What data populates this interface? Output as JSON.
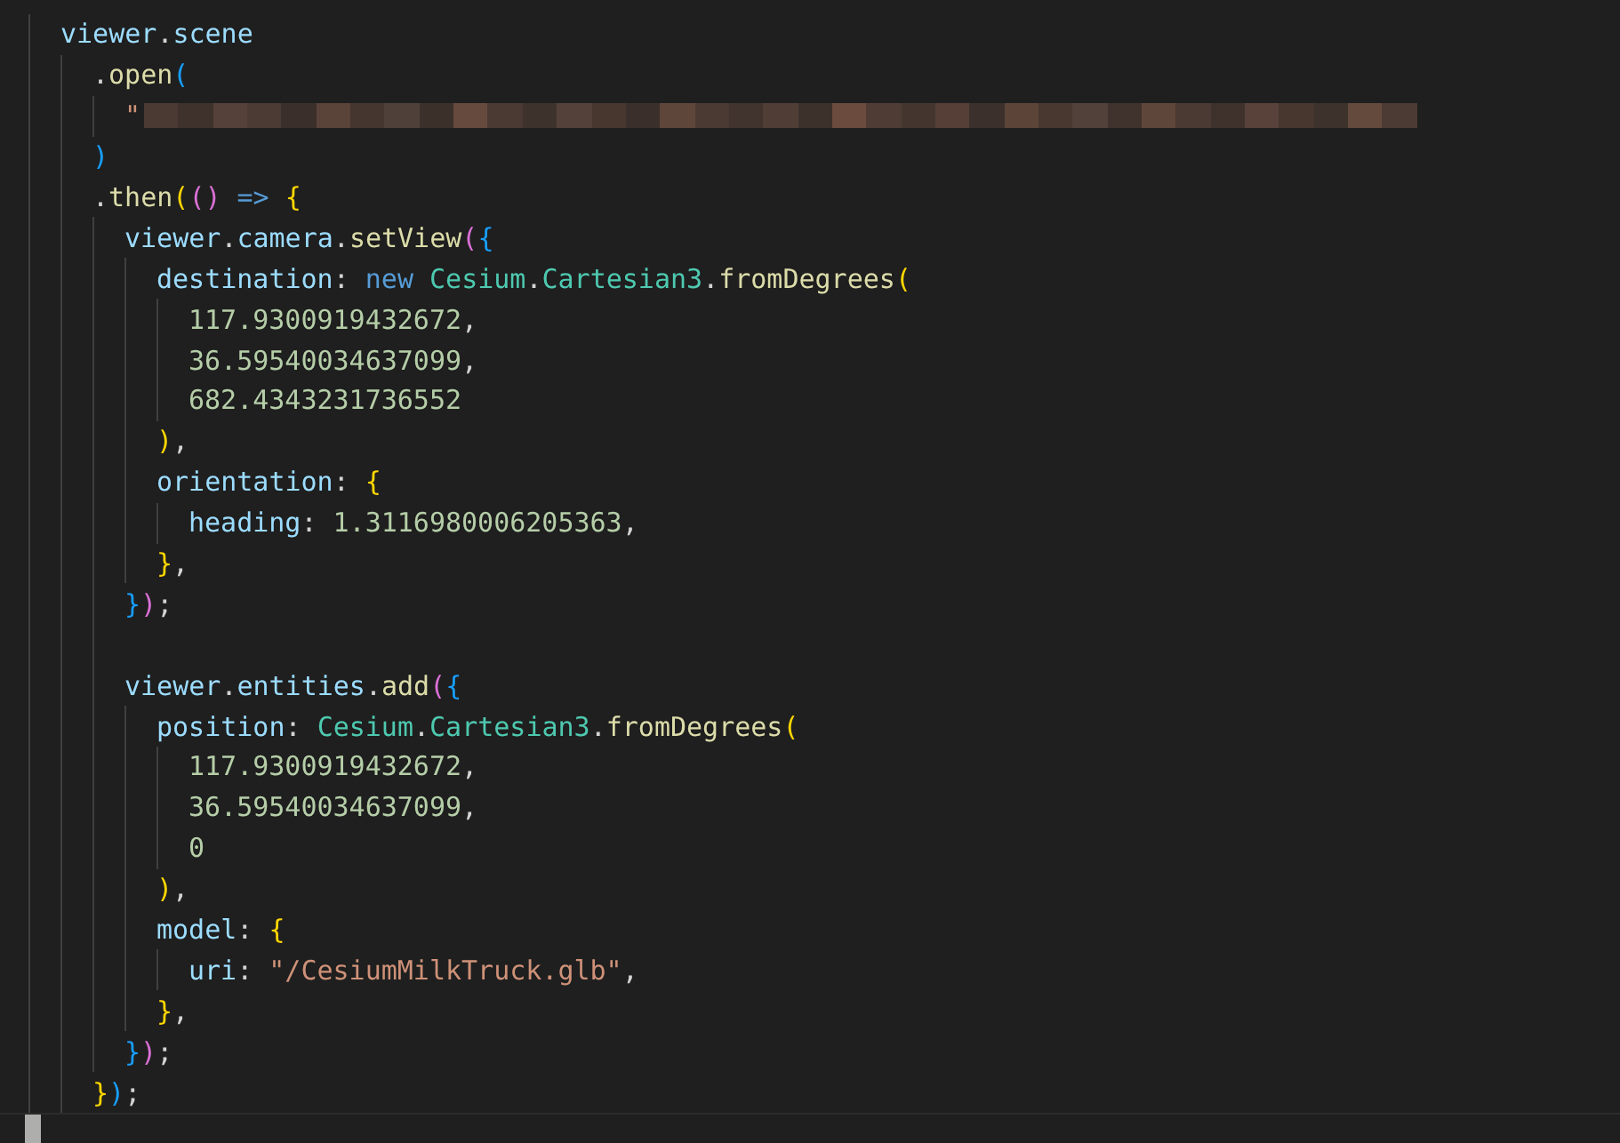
{
  "editor": {
    "lines": [
      {
        "tokens": [
          {
            "kind": "var",
            "text": "viewer"
          },
          {
            "kind": "punc",
            "text": "."
          },
          {
            "kind": "var",
            "text": "scene"
          }
        ],
        "children": [
          {
            "tokens": [
              {
                "kind": "punc",
                "text": "."
              },
              {
                "kind": "fn",
                "text": "open"
              },
              {
                "kind": "b3",
                "text": "("
              }
            ],
            "children": [
              {
                "tokens": [
                  {
                    "kind": "str",
                    "text": "\""
                  }
                ],
                "redacted": true
              }
            ]
          },
          {
            "tokens": [
              {
                "kind": "b3",
                "text": ")"
              }
            ]
          },
          {
            "tokens": [
              {
                "kind": "punc",
                "text": "."
              },
              {
                "kind": "fn",
                "text": "then"
              },
              {
                "kind": "b1",
                "text": "("
              },
              {
                "kind": "b2",
                "text": "()"
              },
              {
                "kind": "kw",
                "text": " => "
              },
              {
                "kind": "b1",
                "text": "{"
              }
            ],
            "children": [
              {
                "tokens": [
                  {
                    "kind": "var",
                    "text": "viewer"
                  },
                  {
                    "kind": "punc",
                    "text": "."
                  },
                  {
                    "kind": "var",
                    "text": "camera"
                  },
                  {
                    "kind": "punc",
                    "text": "."
                  },
                  {
                    "kind": "fn",
                    "text": "setView"
                  },
                  {
                    "kind": "b2",
                    "text": "("
                  },
                  {
                    "kind": "b3",
                    "text": "{"
                  }
                ],
                "children": [
                  {
                    "tokens": [
                      {
                        "kind": "var",
                        "text": "destination"
                      },
                      {
                        "kind": "punc",
                        "text": ": "
                      },
                      {
                        "kind": "kw",
                        "text": "new "
                      },
                      {
                        "kind": "cls",
                        "text": "Cesium"
                      },
                      {
                        "kind": "punc",
                        "text": "."
                      },
                      {
                        "kind": "cls",
                        "text": "Cartesian3"
                      },
                      {
                        "kind": "punc",
                        "text": "."
                      },
                      {
                        "kind": "fn",
                        "text": "fromDegrees"
                      },
                      {
                        "kind": "b1",
                        "text": "("
                      }
                    ],
                    "children": [
                      {
                        "tokens": [
                          {
                            "kind": "num",
                            "text": "117.9300919432672"
                          },
                          {
                            "kind": "punc",
                            "text": ","
                          }
                        ]
                      },
                      {
                        "tokens": [
                          {
                            "kind": "num",
                            "text": "36.59540034637099"
                          },
                          {
                            "kind": "punc",
                            "text": ","
                          }
                        ]
                      },
                      {
                        "tokens": [
                          {
                            "kind": "num",
                            "text": "682.4343231736552"
                          }
                        ]
                      }
                    ]
                  },
                  {
                    "tokens": [
                      {
                        "kind": "b1",
                        "text": ")"
                      },
                      {
                        "kind": "punc",
                        "text": ","
                      }
                    ]
                  },
                  {
                    "tokens": [
                      {
                        "kind": "var",
                        "text": "orientation"
                      },
                      {
                        "kind": "punc",
                        "text": ": "
                      },
                      {
                        "kind": "b1",
                        "text": "{"
                      }
                    ],
                    "children": [
                      {
                        "tokens": [
                          {
                            "kind": "var",
                            "text": "heading"
                          },
                          {
                            "kind": "punc",
                            "text": ": "
                          },
                          {
                            "kind": "num",
                            "text": "1.3116980006205363"
                          },
                          {
                            "kind": "punc",
                            "text": ","
                          }
                        ]
                      }
                    ]
                  },
                  {
                    "tokens": [
                      {
                        "kind": "b1",
                        "text": "}"
                      },
                      {
                        "kind": "punc",
                        "text": ","
                      }
                    ]
                  }
                ]
              },
              {
                "tokens": [
                  {
                    "kind": "b3",
                    "text": "}"
                  },
                  {
                    "kind": "b2",
                    "text": ")"
                  },
                  {
                    "kind": "punc",
                    "text": ";"
                  }
                ]
              },
              {
                "gap_before": true,
                "tokens": [
                  {
                    "kind": "var",
                    "text": "viewer"
                  },
                  {
                    "kind": "punc",
                    "text": "."
                  },
                  {
                    "kind": "var",
                    "text": "entities"
                  },
                  {
                    "kind": "punc",
                    "text": "."
                  },
                  {
                    "kind": "fn",
                    "text": "add"
                  },
                  {
                    "kind": "b2",
                    "text": "("
                  },
                  {
                    "kind": "b3",
                    "text": "{"
                  }
                ],
                "children": [
                  {
                    "tokens": [
                      {
                        "kind": "var",
                        "text": "position"
                      },
                      {
                        "kind": "punc",
                        "text": ": "
                      },
                      {
                        "kind": "cls",
                        "text": "Cesium"
                      },
                      {
                        "kind": "punc",
                        "text": "."
                      },
                      {
                        "kind": "cls",
                        "text": "Cartesian3"
                      },
                      {
                        "kind": "punc",
                        "text": "."
                      },
                      {
                        "kind": "fn",
                        "text": "fromDegrees"
                      },
                      {
                        "kind": "b1",
                        "text": "("
                      }
                    ],
                    "children": [
                      {
                        "tokens": [
                          {
                            "kind": "num",
                            "text": "117.9300919432672"
                          },
                          {
                            "kind": "punc",
                            "text": ","
                          }
                        ]
                      },
                      {
                        "tokens": [
                          {
                            "kind": "num",
                            "text": "36.59540034637099"
                          },
                          {
                            "kind": "punc",
                            "text": ","
                          }
                        ]
                      },
                      {
                        "tokens": [
                          {
                            "kind": "num",
                            "text": "0"
                          }
                        ]
                      }
                    ]
                  },
                  {
                    "tokens": [
                      {
                        "kind": "b1",
                        "text": ")"
                      },
                      {
                        "kind": "punc",
                        "text": ","
                      }
                    ]
                  },
                  {
                    "tokens": [
                      {
                        "kind": "var",
                        "text": "model"
                      },
                      {
                        "kind": "punc",
                        "text": ": "
                      },
                      {
                        "kind": "b1",
                        "text": "{"
                      }
                    ],
                    "children": [
                      {
                        "tokens": [
                          {
                            "kind": "var",
                            "text": "uri"
                          },
                          {
                            "kind": "punc",
                            "text": ": "
                          },
                          {
                            "kind": "str",
                            "text": "\"/CesiumMilkTruck.glb\""
                          },
                          {
                            "kind": "punc",
                            "text": ","
                          }
                        ]
                      }
                    ]
                  },
                  {
                    "tokens": [
                      {
                        "kind": "b1",
                        "text": "}"
                      },
                      {
                        "kind": "punc",
                        "text": ","
                      }
                    ]
                  }
                ]
              },
              {
                "tokens": [
                  {
                    "kind": "b3",
                    "text": "}"
                  },
                  {
                    "kind": "b2",
                    "text": ")"
                  },
                  {
                    "kind": "punc",
                    "text": ";"
                  }
                ]
              }
            ]
          },
          {
            "tokens": [
              {
                "kind": "b1",
                "text": "}"
              },
              {
                "kind": "b3",
                "text": ")"
              },
              {
                "kind": "punc",
                "text": ";"
              }
            ]
          }
        ]
      }
    ]
  }
}
